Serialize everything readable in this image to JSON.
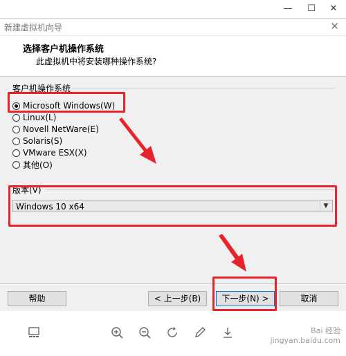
{
  "dialog": {
    "title": "新建虚拟机向导",
    "close_glyph": "✕",
    "header_title": "选择客户机操作系统",
    "header_subtitle": "此虚拟机中将安装哪种操作系统?"
  },
  "os_group": {
    "label": "客户机操作系统",
    "options": [
      {
        "label": "Microsoft Windows(W)",
        "checked": true
      },
      {
        "label": "Linux(L)",
        "checked": false
      },
      {
        "label": "Novell NetWare(E)",
        "checked": false
      },
      {
        "label": "Solaris(S)",
        "checked": false
      },
      {
        "label": "VMware ESX(X)",
        "checked": false
      },
      {
        "label": "其他(O)",
        "checked": false
      }
    ]
  },
  "version": {
    "label": "版本(V)",
    "selected": "Windows 10 x64"
  },
  "buttons": {
    "help": "帮助",
    "back": "< 上一步(B)",
    "next": "下一步(N) >",
    "cancel": "取消"
  },
  "window_controls": {
    "minimize": "—",
    "maximize": "☐",
    "close": "✕"
  },
  "watermark": {
    "line1": "Bai 经验",
    "line2": "jingyan.baidu.com"
  },
  "colors": {
    "annotation_red": "#e8232c"
  }
}
